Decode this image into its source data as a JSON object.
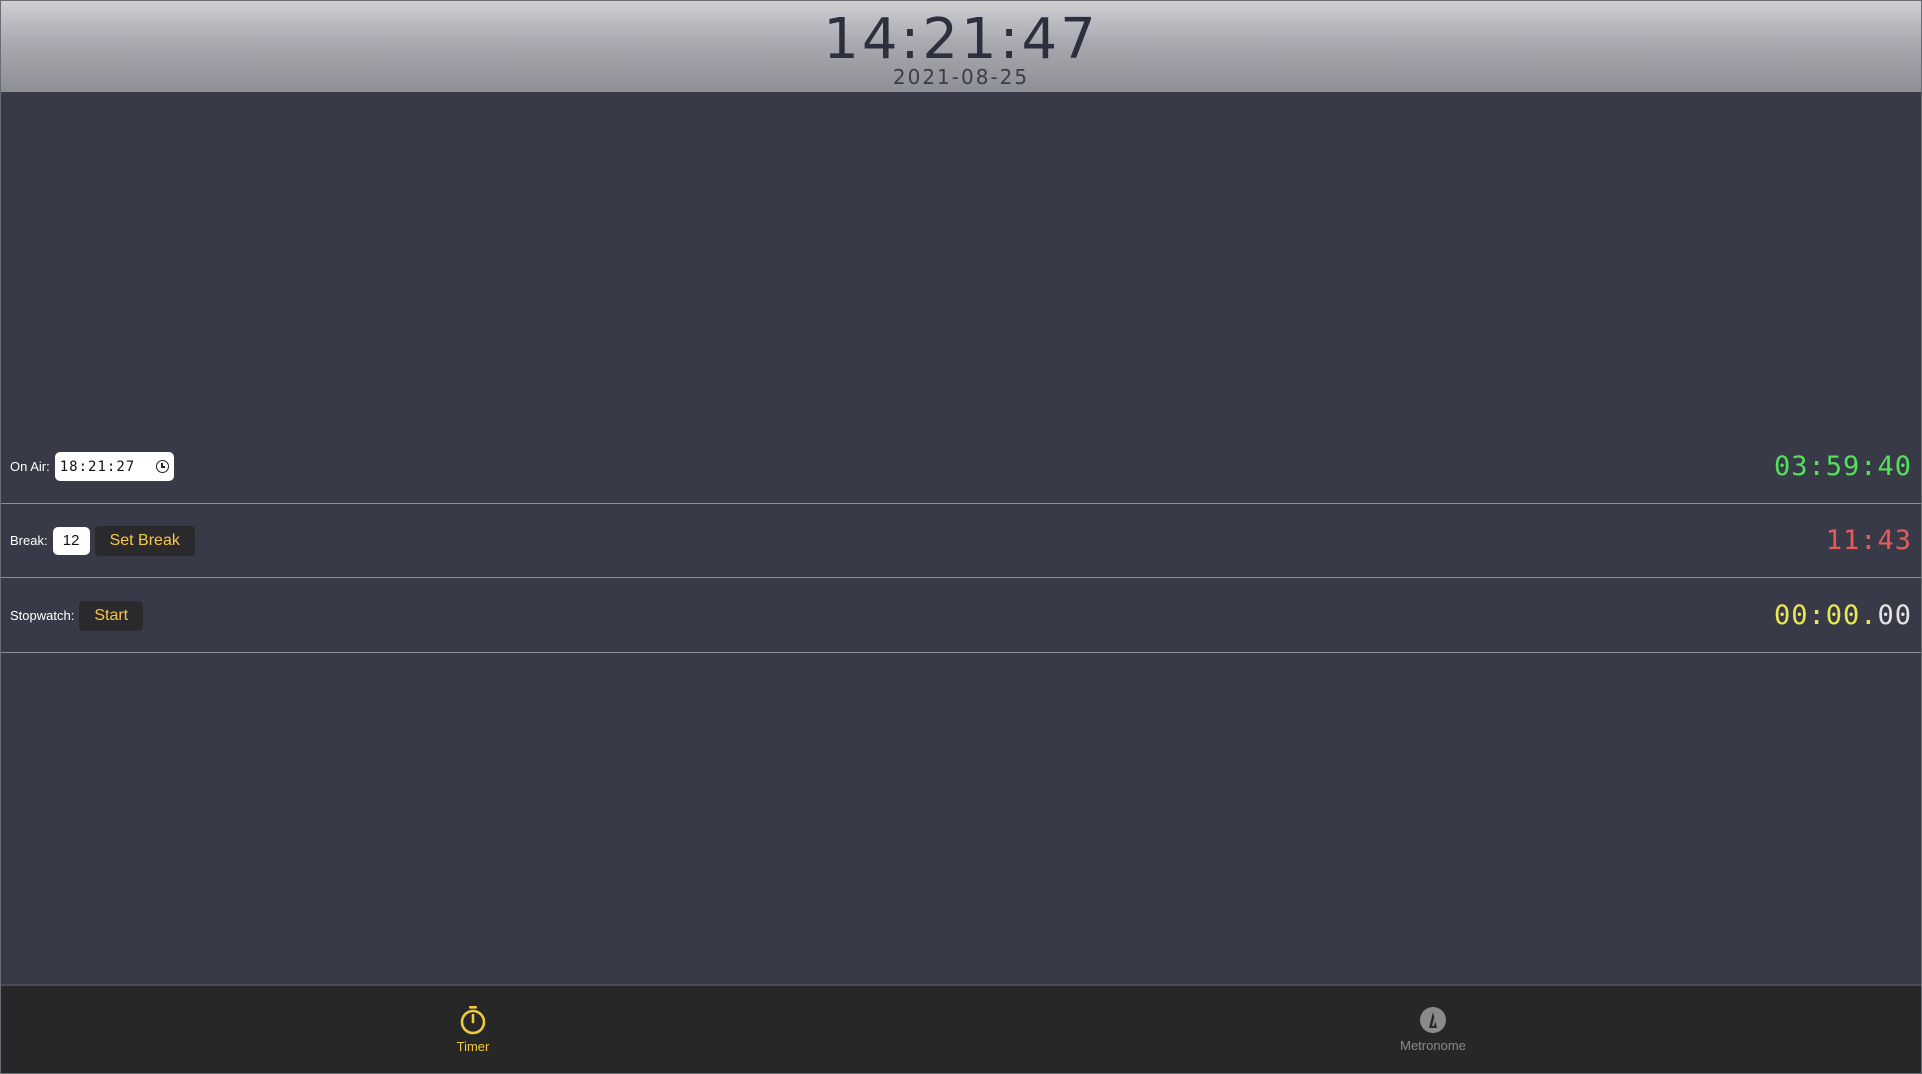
{
  "header": {
    "clock": "14:21:47",
    "date": "2021-08-25"
  },
  "on_air": {
    "label": "On Air:",
    "time_value": "18:21:27",
    "countdown": "03:59:40"
  },
  "break": {
    "label": "Break:",
    "minutes_value": "12",
    "set_button": "Set Break",
    "countdown": "11:43"
  },
  "stopwatch": {
    "label": "Stopwatch:",
    "start_button": "Start",
    "time_main": "00:00.",
    "time_fraction": "00"
  },
  "tabs": [
    {
      "label": "Timer",
      "icon": "stopwatch-icon",
      "active": true
    },
    {
      "label": "Metronome",
      "icon": "metronome-icon",
      "active": false
    }
  ],
  "colors": {
    "background": "#383a48",
    "accent": "#f0c93e",
    "green": "#55e05a",
    "red": "#e85a5c",
    "yellow": "#e8e854"
  }
}
